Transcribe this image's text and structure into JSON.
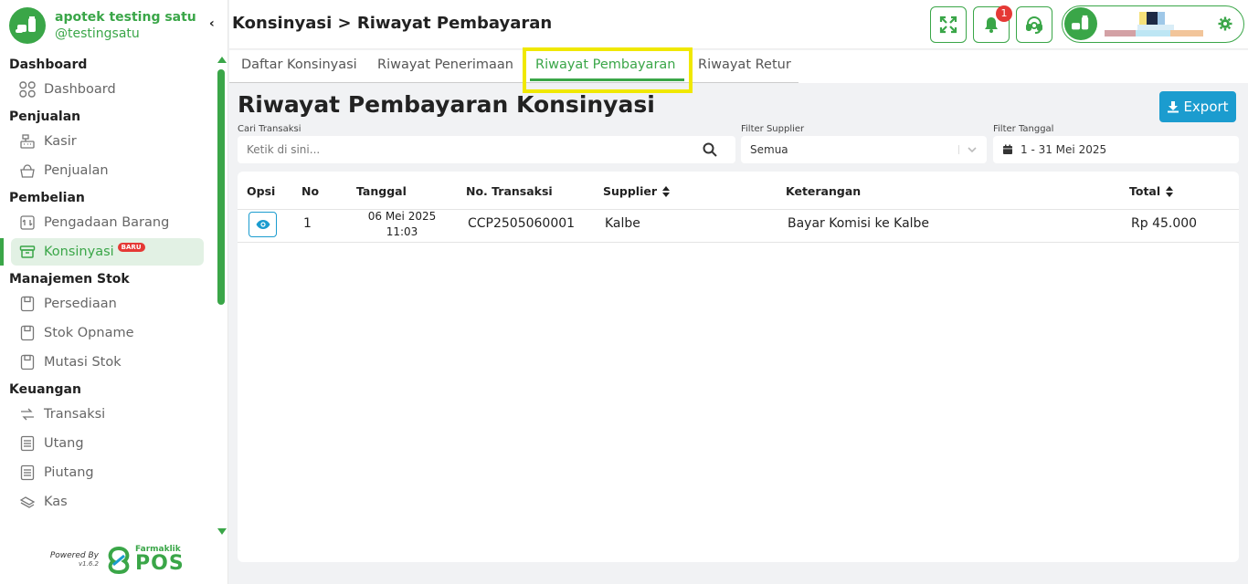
{
  "brand": {
    "name": "apotek testing satu",
    "handle": "@testingsatu"
  },
  "header": {
    "title": "Konsinyasi > Riwayat Pembayaran",
    "notification_count": "1"
  },
  "sidebar": {
    "sections": [
      {
        "title": "Dashboard",
        "items": [
          {
            "label": "Dashboard",
            "icon": "grid-icon"
          }
        ]
      },
      {
        "title": "Penjualan",
        "items": [
          {
            "label": "Kasir",
            "icon": "cash-register-icon"
          },
          {
            "label": "Penjualan",
            "icon": "basket-icon"
          }
        ]
      },
      {
        "title": "Pembelian",
        "items": [
          {
            "label": "Pengadaan Barang",
            "icon": "procurement-icon"
          },
          {
            "label": "Konsinyasi",
            "icon": "box-icon",
            "badge": "BARU",
            "active": true
          }
        ]
      },
      {
        "title": "Manajemen Stok",
        "items": [
          {
            "label": "Persediaan",
            "icon": "inventory-icon"
          },
          {
            "label": "Stok Opname",
            "icon": "stock-opname-icon"
          },
          {
            "label": "Mutasi Stok",
            "icon": "stock-mutation-icon"
          }
        ]
      },
      {
        "title": "Keuangan",
        "items": [
          {
            "label": "Transaksi",
            "icon": "transfer-icon"
          },
          {
            "label": "Utang",
            "icon": "receipt-icon"
          },
          {
            "label": "Piutang",
            "icon": "receipt-icon"
          },
          {
            "label": "Kas",
            "icon": "cash-icon"
          }
        ]
      }
    ],
    "powered_by": "Powered By",
    "version": "v1.6.2",
    "product_small": "Farmaklik",
    "product_big": "POS"
  },
  "tabs": [
    {
      "label": "Daftar Konsinyasi"
    },
    {
      "label": "Riwayat Penerimaan"
    },
    {
      "label": "Riwayat Pembayaran",
      "active": true
    },
    {
      "label": "Riwayat Retur"
    }
  ],
  "content": {
    "title": "Riwayat Pembayaran Konsinyasi",
    "export_label": "Export"
  },
  "filters": {
    "search": {
      "label": "Cari Transaksi",
      "placeholder": "Ketik di sini..."
    },
    "supplier": {
      "label": "Filter Supplier",
      "value": "Semua"
    },
    "date": {
      "label": "Filter Tanggal",
      "value": "1 - 31 Mei 2025"
    }
  },
  "table": {
    "headers": {
      "opsi": "Opsi",
      "no": "No",
      "tanggal": "Tanggal",
      "no_transaksi": "No. Transaksi",
      "supplier": "Supplier",
      "keterangan": "Keterangan",
      "total": "Total"
    },
    "rows": [
      {
        "no": "1",
        "date": "06 Mei 2025",
        "time": "11:03",
        "no_transaksi": "CCP2505060001",
        "supplier": "Kalbe",
        "keterangan": "Bayar Komisi ke Kalbe",
        "total": "Rp 45.000"
      }
    ]
  },
  "colors": {
    "brand_green": "#3aa648",
    "accent_blue": "#1b9ccf",
    "highlight_yellow": "#f0e800",
    "badge_red": "#e53935"
  }
}
